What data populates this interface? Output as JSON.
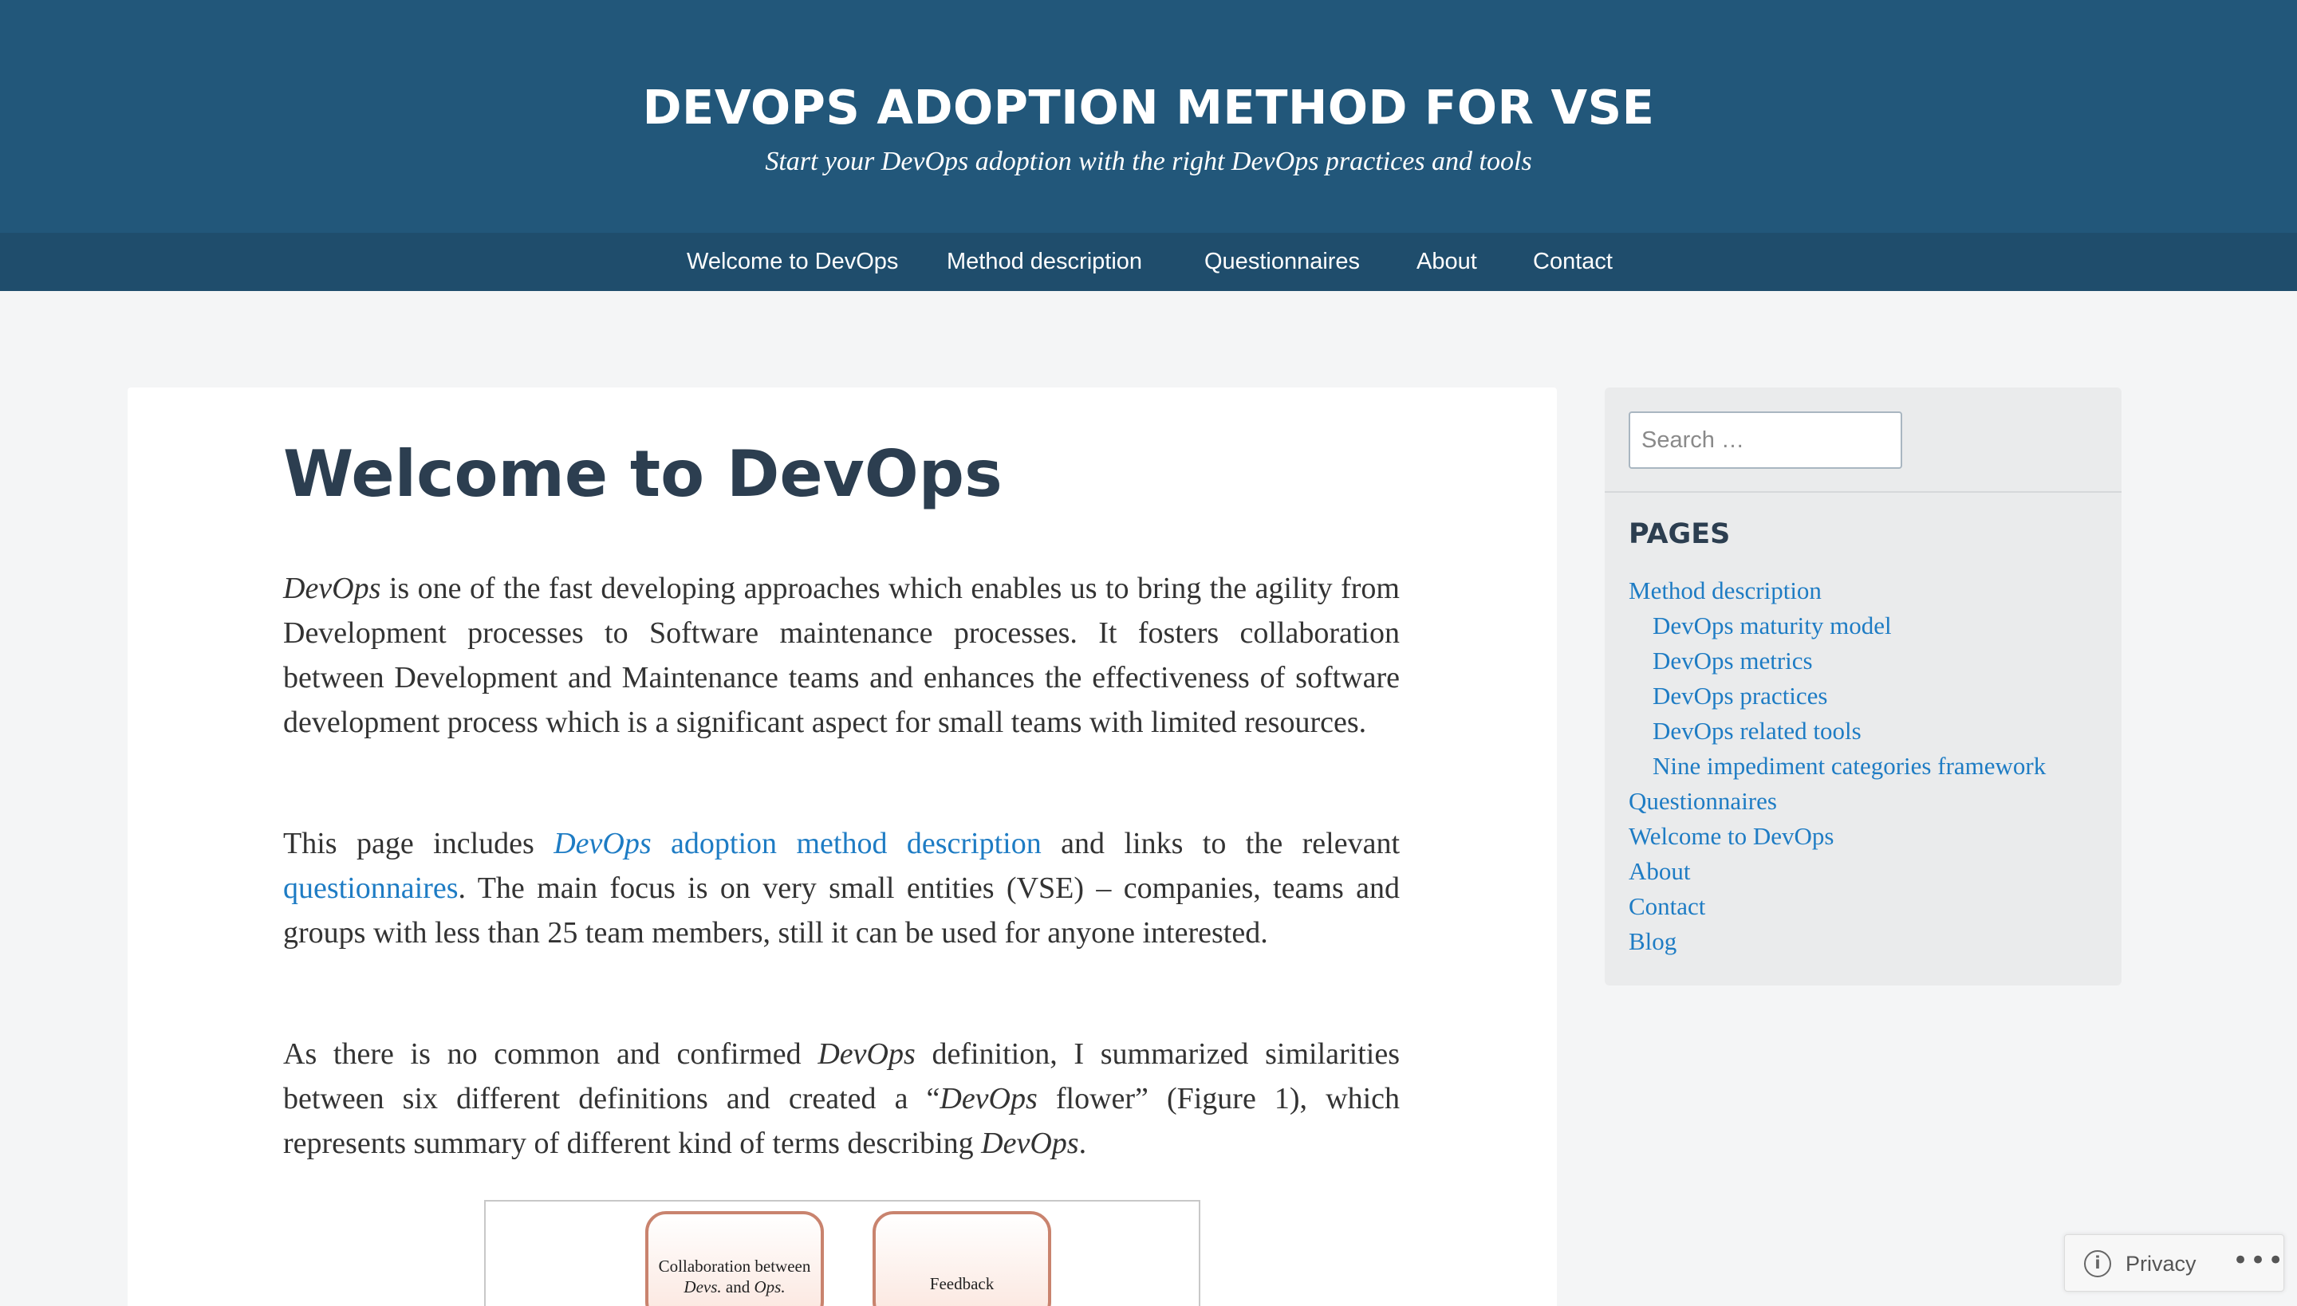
{
  "header": {
    "title": "DEVOPS ADOPTION METHOD FOR VSE",
    "tagline": "Start your DevOps adoption with the right DevOps practices and tools"
  },
  "nav": {
    "items": [
      {
        "label": "Welcome to DevOps"
      },
      {
        "label": "Method description"
      },
      {
        "label": "Questionnaires"
      },
      {
        "label": "About"
      },
      {
        "label": "Contact"
      }
    ]
  },
  "main": {
    "title": "Welcome to DevOps",
    "p1": {
      "em": "DevOps",
      "text": " is one of the fast developing approaches which enables us to bring the agility from Development processes to Software maintenance processes. It fosters collaboration between Development and Maintenance teams and enhances the effectiveness of software development process which is a significant aspect for small teams with limited resources."
    },
    "p2": {
      "t1": "This page includes ",
      "link1_em": "DevOps",
      "link1_text": " adoption method description",
      "t2": " and links to the relevant ",
      "link2": "questionnaires",
      "t3": ". The main focus is on very small entities (VSE) – companies, teams and groups with less than 25 team members, still it can be used for anyone interested."
    },
    "p3": {
      "t1": "As there is no common and confirmed ",
      "em1": "DevOps",
      "t2": " definition, I summarized similarities between six different definitions and created a “",
      "em2": "DevOps",
      "t3": " flower” (Figure 1), which represents summary of different kind of terms describing ",
      "em3": "DevOps",
      "t4": "."
    },
    "figure": {
      "petal1_line1": "Collaboration between",
      "petal1_devs": "Devs.",
      "petal1_and": " and ",
      "petal1_ops": "Ops.",
      "petal2": "Feedback"
    }
  },
  "sidebar": {
    "search_placeholder": "Search …",
    "widget_title": "PAGES",
    "pages": [
      {
        "label": "Method description",
        "level": 0
      },
      {
        "label": "DevOps maturity model",
        "level": 1
      },
      {
        "label": "DevOps metrics",
        "level": 1
      },
      {
        "label": "DevOps practices",
        "level": 1
      },
      {
        "label": "DevOps related tools",
        "level": 1
      },
      {
        "label": "Nine impediment categories framework",
        "level": 1
      },
      {
        "label": "Questionnaires",
        "level": 0
      },
      {
        "label": "Welcome to DevOps",
        "level": 0
      },
      {
        "label": "About",
        "level": 0
      },
      {
        "label": "Contact",
        "level": 0
      },
      {
        "label": "Blog",
        "level": 0
      }
    ]
  },
  "privacy": {
    "label": "Privacy",
    "info_icon": "info-icon",
    "more_icon": "more-icon"
  },
  "colors": {
    "header_bg": "#22577a",
    "nav_bg": "#1f4d6c",
    "link": "#1e7cc4",
    "heading": "#2c3e50",
    "page_bg": "#f4f5f6"
  }
}
